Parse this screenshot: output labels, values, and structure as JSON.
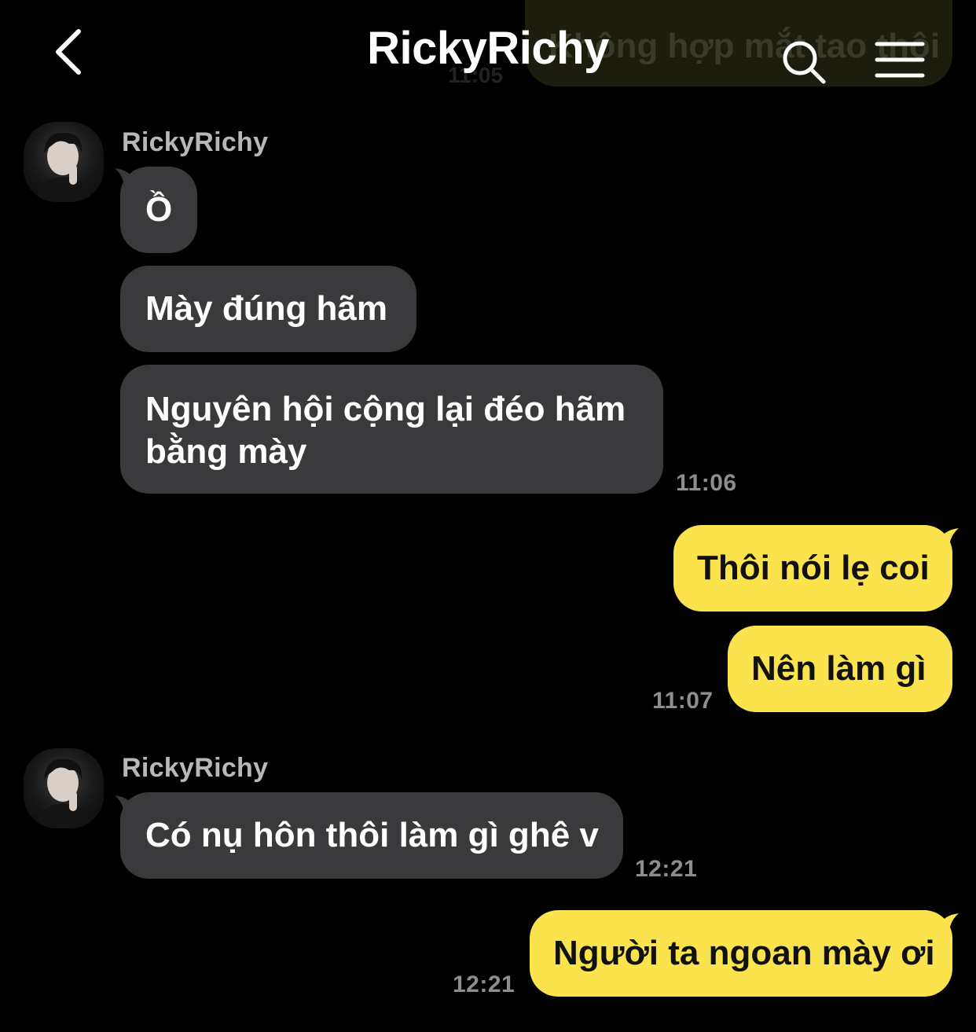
{
  "header": {
    "title": "RickyRichy",
    "back_icon": "chevron-left-icon",
    "search_icon": "search-icon",
    "menu_icon": "hamburger-menu-icon"
  },
  "previous": {
    "partial_text": "Không hợp mắt tao thôi",
    "time": "11:05"
  },
  "groups": [
    {
      "sender": "RickyRichy",
      "messages": [
        "Ồ",
        "Mày đúng hãm",
        "Nguyên hội cộng lại đéo hãm",
        "bằng mày"
      ],
      "time": "11:06"
    },
    {
      "sender": "me",
      "messages": [
        "Thôi nói lẹ coi",
        "Nên làm gì"
      ],
      "time": "11:07"
    },
    {
      "sender": "RickyRichy",
      "messages": [
        "Có nụ hôn thôi làm gì ghê v"
      ],
      "time": "12:21"
    },
    {
      "sender": "me",
      "messages": [
        "Người ta ngoan mày ơi"
      ],
      "time": "12:21"
    }
  ],
  "colors": {
    "background": "#000000",
    "incoming_bubble": "#3a3a3c",
    "outgoing_bubble": "#fbe34e",
    "timestamp": "#8e8e8e"
  }
}
